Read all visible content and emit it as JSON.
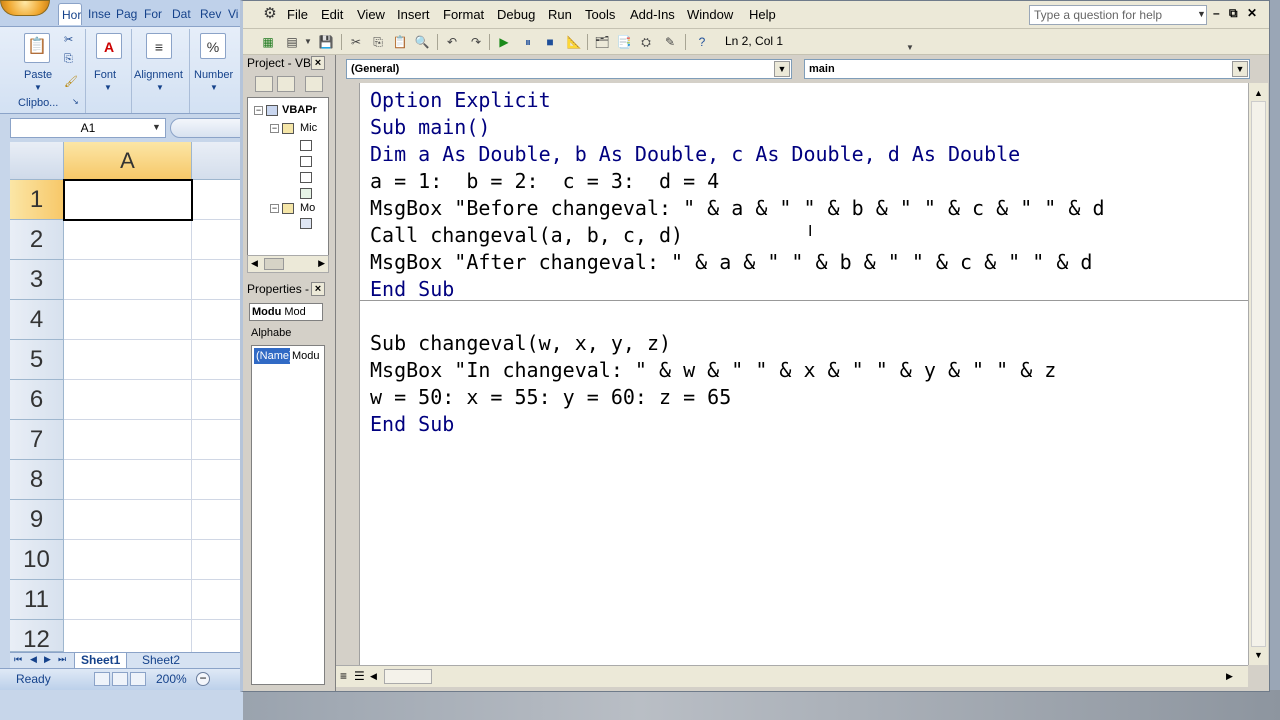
{
  "excel": {
    "ribbon_tabs": [
      "Hor",
      "Inse",
      "Pag",
      "For",
      "Dat",
      "Rev",
      "Vi"
    ],
    "groups": {
      "paste": "Paste",
      "clipboard": "Clipbo...",
      "font": "Font",
      "alignment": "Alignment",
      "number": "Number",
      "percent": "%"
    },
    "name_box": "A1",
    "column_header": "A",
    "rows": [
      "1",
      "2",
      "3",
      "4",
      "5",
      "6",
      "7",
      "8",
      "9",
      "10",
      "11",
      "12"
    ],
    "sheet_tabs": [
      "Sheet1",
      "Sheet2"
    ],
    "status": "Ready",
    "zoom": "200%"
  },
  "vbe": {
    "menus": [
      "File",
      "Edit",
      "View",
      "Insert",
      "Format",
      "Debug",
      "Run",
      "Tools",
      "Add-Ins",
      "Window",
      "Help"
    ],
    "question_placeholder": "Type a question for help",
    "position": "Ln 2, Col 1",
    "project_title": "Project - VB",
    "project_tree": [
      "VBAPr",
      "Mic",
      "Mo"
    ],
    "properties_title": "Properties -",
    "properties_combo": [
      "Modu",
      "Mod"
    ],
    "properties_tab": "Alphabe",
    "property_name": "(Name)",
    "property_value": "Modu",
    "object_combo": "(General)",
    "procedure_combo": "main",
    "code_lines": [
      "Option Explicit",
      "Sub main()",
      "Dim a As Double, b As Double, c As Double, d As Double",
      "a = 1:  b = 2:  c = 3:  d = 4",
      "MsgBox \"Before changeval: \" & a & \" \" & b & \" \" & c & \" \" & d",
      "Call changeval(a, b, c, d)",
      "MsgBox \"After changeval: \" & a & \" \" & b & \" \" & c & \" \" & d",
      "End Sub",
      "",
      "Sub changeval(w, x, y, z)",
      "MsgBox \"In changeval: \" & w & \" \" & x & \" \" & y & \" \" & z",
      "w = 50: x = 55: y = 60: z = 65",
      "End Sub"
    ],
    "keyword_color": "#00007f"
  }
}
